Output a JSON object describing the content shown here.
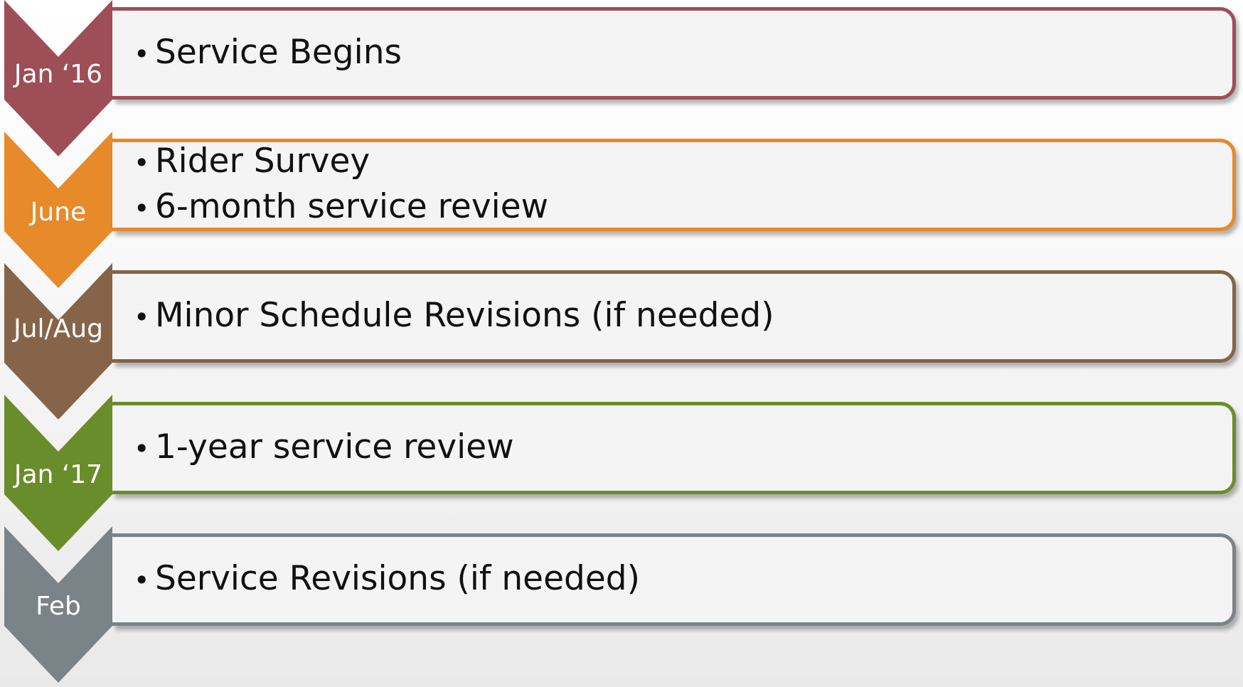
{
  "timeline": [
    {
      "label": "Jan ‘16",
      "color": "#9e4e57",
      "items": [
        "Service Begins"
      ]
    },
    {
      "label": "June",
      "color": "#e68a2a",
      "items": [
        "Rider Survey",
        "6-month service review"
      ]
    },
    {
      "label": "Jul/Aug",
      "color": "#866449",
      "items": [
        "Minor Schedule Revisions (if needed)"
      ]
    },
    {
      "label": "Jan ‘17",
      "color": "#6a8d2b",
      "items": [
        "1-year service review"
      ]
    },
    {
      "label": "Feb",
      "color": "#7a8488",
      "items": [
        "Service Revisions (if needed)"
      ]
    }
  ]
}
